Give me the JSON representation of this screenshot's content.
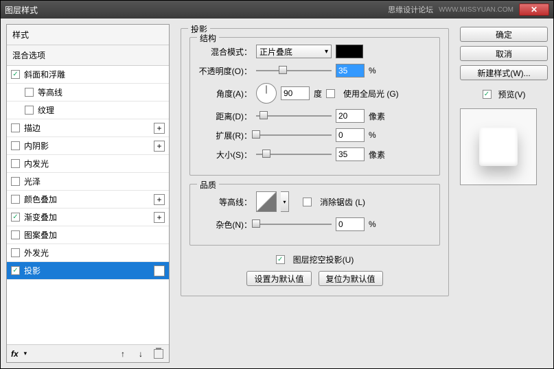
{
  "titlebar": {
    "title": "图层样式",
    "rightText": "思缘设计论坛",
    "url": "WWW.MISSYUAN.COM"
  },
  "left": {
    "header": "样式",
    "sub": "混合选项",
    "items": [
      {
        "label": "斜面和浮雕",
        "checked": true,
        "plus": false,
        "indent": false
      },
      {
        "label": "等高线",
        "checked": false,
        "plus": false,
        "indent": true
      },
      {
        "label": "纹理",
        "checked": false,
        "plus": false,
        "indent": true
      },
      {
        "label": "描边",
        "checked": false,
        "plus": true,
        "indent": false
      },
      {
        "label": "内阴影",
        "checked": false,
        "plus": true,
        "indent": false
      },
      {
        "label": "内发光",
        "checked": false,
        "plus": false,
        "indent": false
      },
      {
        "label": "光泽",
        "checked": false,
        "plus": false,
        "indent": false
      },
      {
        "label": "颜色叠加",
        "checked": false,
        "plus": true,
        "indent": false
      },
      {
        "label": "渐变叠加",
        "checked": true,
        "plus": true,
        "indent": false
      },
      {
        "label": "图案叠加",
        "checked": false,
        "plus": false,
        "indent": false
      },
      {
        "label": "外发光",
        "checked": false,
        "plus": false,
        "indent": false
      },
      {
        "label": "投影",
        "checked": true,
        "plus": true,
        "indent": false,
        "selected": true
      }
    ],
    "footer": {
      "fx": "fx"
    }
  },
  "center": {
    "groupTitle": "投影",
    "structure": {
      "legend": "结构",
      "blendModeLabel": "混合模式：",
      "blendModeValue": "正片叠底",
      "opacityLabel": "不透明度(O)：",
      "opacityValue": "35",
      "opacityUnit": "%",
      "angleLabel": "角度(A)：",
      "angleValue": "90",
      "angleUnit": "度",
      "globalLightLabel": "使用全局光 (G)",
      "globalLightChecked": false,
      "distanceLabel": "距离(D)：",
      "distanceValue": "20",
      "distanceUnit": "像素",
      "spreadLabel": "扩展(R)：",
      "spreadValue": "0",
      "spreadUnit": "%",
      "sizeLabel": "大小(S)：",
      "sizeValue": "35",
      "sizeUnit": "像素"
    },
    "quality": {
      "legend": "品质",
      "contourLabel": "等高线：",
      "antiAliasLabel": "消除锯齿 (L)",
      "antiAliasChecked": false,
      "noiseLabel": "杂色(N)：",
      "noiseValue": "0",
      "noiseUnit": "%"
    },
    "knockout": {
      "label": "图层挖空投影(U)",
      "checked": true
    },
    "buttons": {
      "default": "设置为默认值",
      "reset": "复位为默认值"
    }
  },
  "right": {
    "ok": "确定",
    "cancel": "取消",
    "newStyle": "新建样式(W)...",
    "previewLabel": "预览(V)",
    "previewChecked": true
  }
}
